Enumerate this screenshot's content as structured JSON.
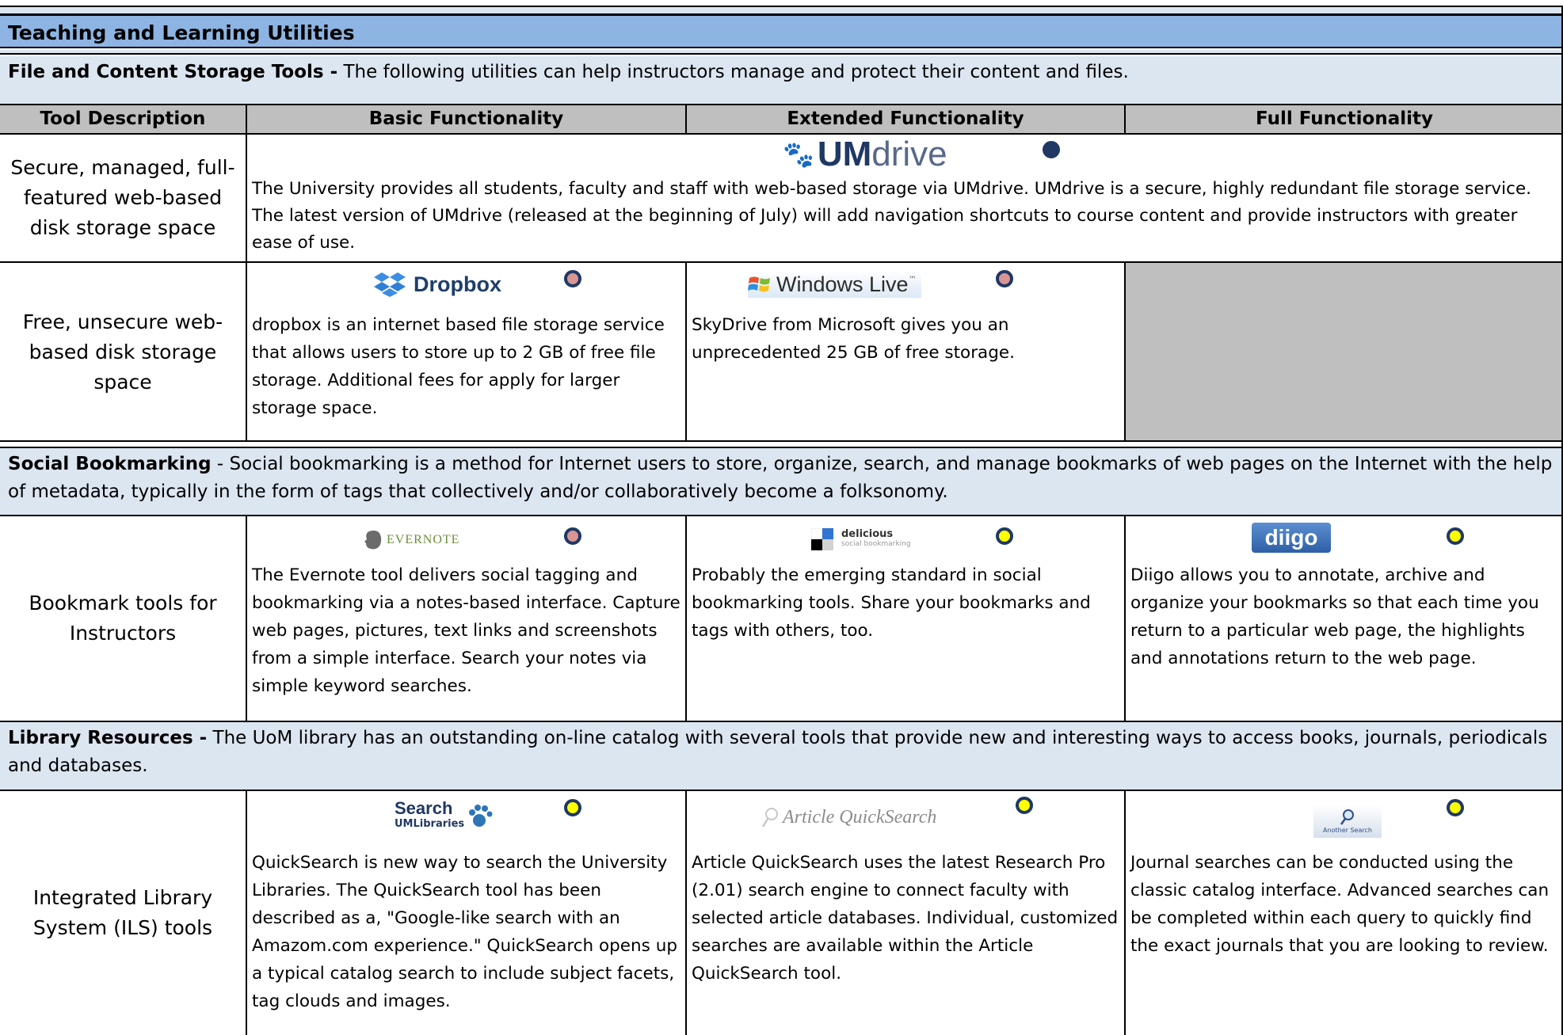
{
  "title": "Teaching and Learning Utilities",
  "sections": {
    "file_storage": {
      "heading": "File and Content Storage Tools -",
      "text": " The following utilities can help instructors manage and protect their content and files."
    },
    "social": {
      "heading": "Social Bookmarking",
      "text": " - Social bookmarking is a method for Internet users to store, organize, search, and manage bookmarks of web pages on the Internet with the help of metadata, typically in the form of tags that collectively and/or collaboratively become a folksonomy."
    },
    "library": {
      "heading": "Library Resources -",
      "text": " The UoM library has an outstanding  on-line catalog with several tools that provide new and interesting ways to access books, journals, periodicals and databases."
    }
  },
  "columns": [
    "Tool Description",
    "Basic Functionality",
    "Extended Functionality",
    "Full Functionality"
  ],
  "rows": {
    "secure": {
      "desc": "Secure, managed, full-featured web-based disk storage space",
      "logo_paw": "🐾",
      "logo_um": "UM",
      "logo_drive": "drive",
      "text": "The University provides all students, faculty and staff with web-based storage via UMdrive.  UMdrive is a secure, highly redundant file storage service. The latest version of UMdrive (released at the beginning of July) will add navigation shortcuts to course content and provide instructors with greater ease of use."
    },
    "free": {
      "desc": "Free, unsecure web-based disk storage space",
      "dropbox_logo": "Dropbox",
      "dropbox_text": "dropbox is an internet based file storage service that allows users to store up to 2 GB of free file storage.  Additional fees for apply for larger storage space.",
      "windows_logo": "Windows Live",
      "windows_tm": "™",
      "windows_text": "SkyDrive from Microsoft gives you an unprecedented 25 GB of free storage."
    },
    "bookmark": {
      "desc": "Bookmark tools for Instructors",
      "evernote_logo": "EVERNOTE",
      "evernote_text": "The Evernote tool delivers social tagging and bookmarking via a notes-based interface. Capture web pages, pictures, text links and screenshots from a simple interface.  Search your notes via simple keyword searches.",
      "delicious_logo": "delicious",
      "delicious_sub": "social bookmarking",
      "delicious_text": "Probably the emerging standard in social bookmarking tools.  Share your bookmarks and tags with others, too.",
      "diigo_logo": "diigo",
      "diigo_text": "Diigo allows you to annotate, archive and organize your bookmarks so that each time you return to a particular web page, the highlights and annotations return to the web page."
    },
    "ils": {
      "desc": "Integrated Library System (ILS) tools",
      "search_logo": "Search",
      "search_sub": "UMLibraries",
      "search_text": "QuickSearch is new way to search the University Libraries.  The QuickSearch tool has been described as a, \"Google-like search with an Amazom.com experience.\" QuickSearch opens up a typical catalog search to include subject facets, tag clouds and images.",
      "article_logo": "Article QuickSearch",
      "article_text": "Article QuickSearch uses the latest Research Pro (2.01) search engine to connect faculty with selected article databases.  Individual, customized searches are available within the Article QuickSearch tool.",
      "another_logo": "Another Search",
      "another_text": "Journal searches can be conducted using the classic catalog interface.  Advanced searches can be completed within each query to quickly find the exact journals that you are looking to review."
    }
  },
  "colors": {
    "title_bg": "#8db4e2",
    "section_bg": "#dce6f1",
    "header_bg": "#bfbfbf",
    "empty_cell": "#bfbfbf",
    "dot_navy": "#1f3864",
    "dot_rose": "#d99594",
    "dot_yellow": "#ffff00"
  },
  "icons": [
    "paw-icon",
    "dropbox-icon",
    "windows-flag-icon",
    "evernote-elephant-icon",
    "delicious-squares-icon",
    "magnifier-icon"
  ]
}
